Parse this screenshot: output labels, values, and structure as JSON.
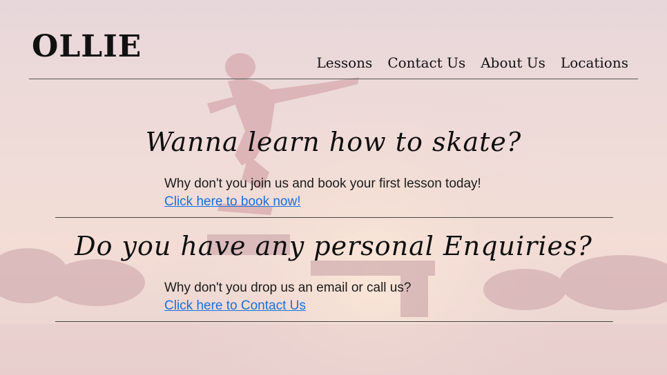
{
  "brand": {
    "name": "OLLIE"
  },
  "nav": {
    "items": [
      {
        "label": "Lessons"
      },
      {
        "label": "Contact Us"
      },
      {
        "label": "About Us"
      },
      {
        "label": "Locations"
      }
    ]
  },
  "sections": [
    {
      "title": "Wanna learn how to skate?",
      "text": "Why don't you join us and book your first lesson today!",
      "link": "Click here to book now!"
    },
    {
      "title": "Do you have any personal Enquiries?",
      "text": "Why don't you drop us an email or call us?",
      "link": "Click here to Contact Us"
    }
  ],
  "colors": {
    "background": "#f0dcd8",
    "link": "#1a6fd8",
    "text": "#111111"
  }
}
